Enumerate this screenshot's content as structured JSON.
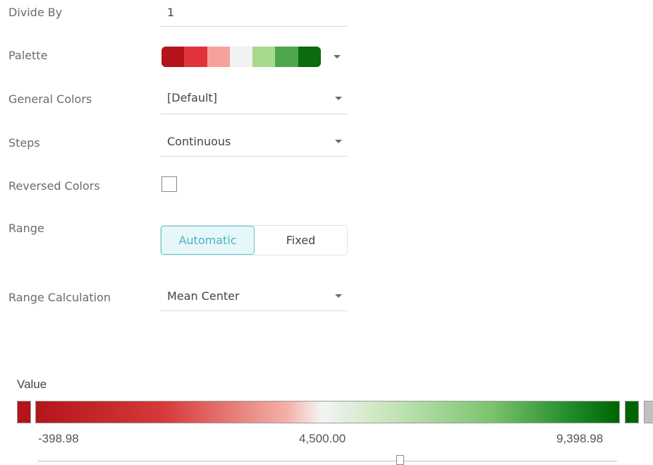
{
  "form": {
    "divide_by": {
      "label": "Divide By",
      "value": "1"
    },
    "palette": {
      "label": "Palette",
      "swatches": [
        "#b3151b",
        "#e0343a",
        "#f5a39a",
        "#f2f2f2",
        "#a7d98f",
        "#4ea64a",
        "#0b6b0f"
      ]
    },
    "general_colors": {
      "label": "General Colors",
      "value": "[Default]"
    },
    "steps": {
      "label": "Steps",
      "value": "Continuous"
    },
    "reversed_colors": {
      "label": "Reversed Colors",
      "checked": false
    },
    "range": {
      "label": "Range",
      "options": [
        "Automatic",
        "Fixed"
      ],
      "selected": "Automatic"
    },
    "range_calculation": {
      "label": "Range Calculation",
      "value": "Mean Center"
    }
  },
  "legend": {
    "title": "Value",
    "min_label": "-398.98",
    "mid_label": "4,500.00",
    "max_label": "9,398.98",
    "below_color": "#b3151b",
    "above_color": "#006400",
    "null_color": "#c0c0c0"
  }
}
